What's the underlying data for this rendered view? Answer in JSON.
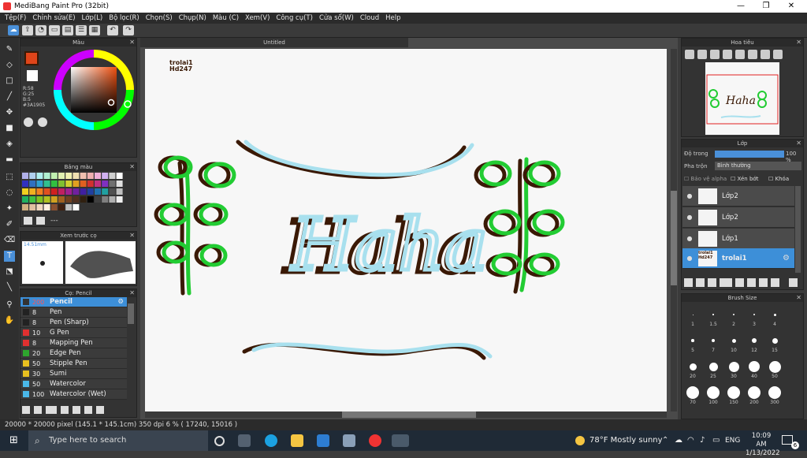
{
  "window": {
    "title": "MediBang Paint Pro (32bit)",
    "min": "—",
    "max": "❐",
    "close": "✕"
  },
  "menu": [
    "Tệp(F)",
    "Chỉnh sửa(E)",
    "Lớp(L)",
    "Bộ lọc(R)",
    "Chọn(S)",
    "Chụp(N)",
    "Màu (C)",
    "Xem(V)",
    "Công cụ(T)",
    "Cửa sổ(W)",
    "Cloud",
    "Help"
  ],
  "panels": {
    "color": {
      "title": "Màu",
      "rgb": {
        "r": "R:58",
        "g": "G:25",
        "b": "B:5"
      },
      "hex": "#3A1905",
      "fg_color": "#3A1905"
    },
    "palette": {
      "title": "Bảng màu",
      "extra": "---"
    },
    "preview": {
      "title": "Xem trước cọ",
      "size": "14.51mm"
    },
    "brush": {
      "title": "Cọ: Pencil",
      "items": [
        {
          "size": "200",
          "name": "Pencil",
          "color": "#3b3b3b"
        },
        {
          "size": "8",
          "name": "Pen",
          "color": "#222222"
        },
        {
          "size": "8",
          "name": "Pen (Sharp)",
          "color": "#222222"
        },
        {
          "size": "10",
          "name": "G Pen",
          "color": "#e03030"
        },
        {
          "size": "8",
          "name": "Mapping Pen",
          "color": "#e03030"
        },
        {
          "size": "20",
          "name": "Edge Pen",
          "color": "#2ea62e"
        },
        {
          "size": "50",
          "name": "Stipple Pen",
          "color": "#e8c020"
        },
        {
          "size": "30",
          "name": "Sumi",
          "color": "#e8c020"
        },
        {
          "size": "50",
          "name": "Watercolor",
          "color": "#4ab8e8"
        },
        {
          "size": "100",
          "name": "Watercolor (Wet)",
          "color": "#4ab8e8"
        }
      ]
    },
    "navigator": {
      "title": "Hoa tiêu"
    },
    "layers": {
      "title": "Lớp",
      "opacity_label": "Độ trong",
      "opacity_value": "100 %",
      "blend_label": "Pha trộn",
      "blend_value": "Bình thường",
      "protect_alpha": "Bảo vệ alpha",
      "clipping": "Xén bớt",
      "lock": "Khóa",
      "items": [
        {
          "name": "Lớp2",
          "selected": false
        },
        {
          "name": "Lớp2",
          "selected": false
        },
        {
          "name": "Lớp1",
          "selected": false
        },
        {
          "name": "trolai1",
          "selected": true
        }
      ]
    },
    "brush_size": {
      "title": "Brush Size",
      "sizes": [
        "1",
        "1.5",
        "2",
        "3",
        "4",
        "5",
        "7",
        "10",
        "12",
        "15",
        "20",
        "25",
        "30",
        "40",
        "50",
        "70",
        "100",
        "150",
        "200",
        "300"
      ]
    }
  },
  "canvas": {
    "tab": "Untitled",
    "stamp_line1": "trolai1",
    "stamp_line2": "Hd247",
    "art_text": "Haha",
    "layer_thumb_text": "trolai1 Hd247"
  },
  "status": "20000 * 20000 pixel   (145.1 * 145.1cm)   350 dpi   6 %   ( 17240, 15016 )",
  "taskbar": {
    "search_placeholder": "Type here to search",
    "weather": "78°F  Mostly sunny",
    "lang": "ENG",
    "time": "10:09 AM",
    "date": "1/13/2022",
    "notif": "6"
  },
  "colors": {
    "accent_blue": "#4a90d9",
    "selected_row": "#3d8fd8",
    "outline_brown": "#3A1905",
    "green": "#22cc33",
    "cyan": "#a8e0ee"
  }
}
